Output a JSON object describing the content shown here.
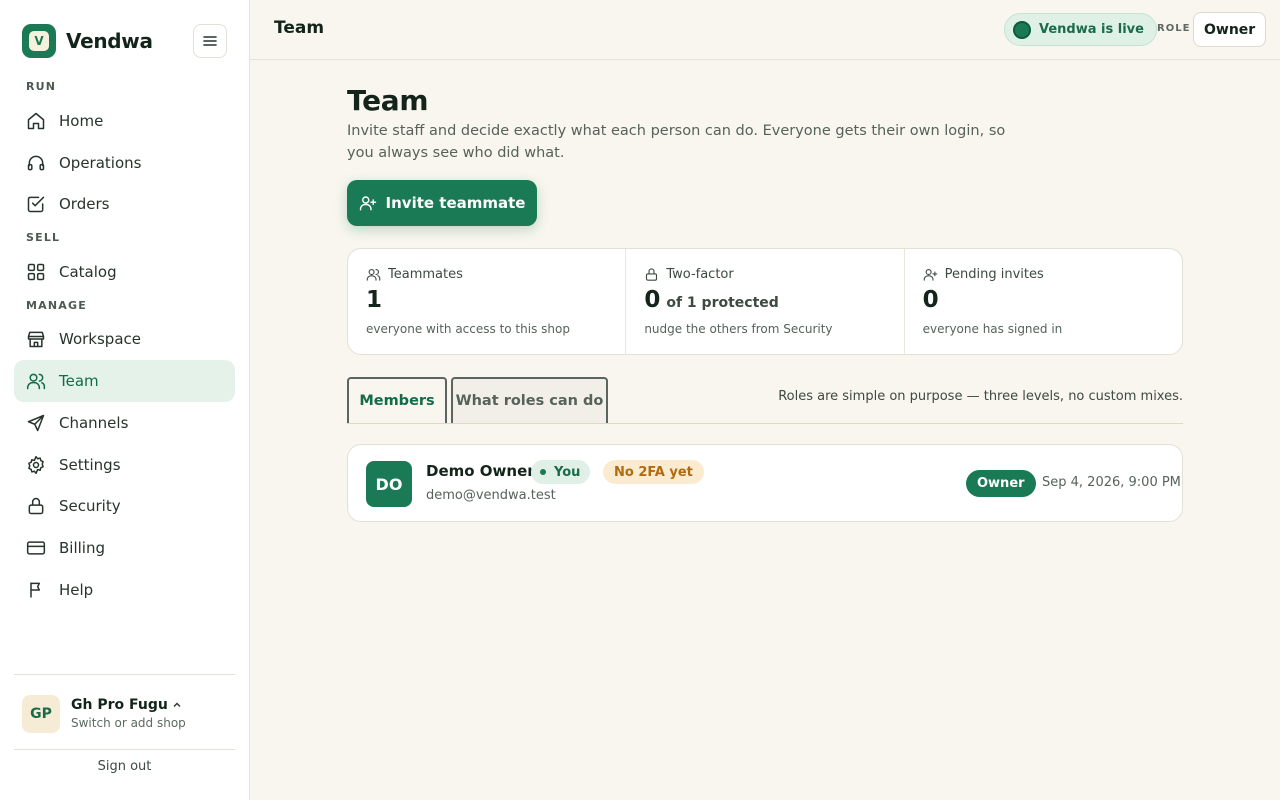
{
  "brand": {
    "name": "Vendwa",
    "logo_letter": "V"
  },
  "sidebar": {
    "sections": {
      "run": "RUN",
      "sell": "SELL",
      "manage": "MANAGE"
    },
    "items": [
      {
        "label": "Home",
        "icon": "home-icon"
      },
      {
        "label": "Operations",
        "icon": "headset-icon"
      },
      {
        "label": "Orders",
        "icon": "checkbox-icon"
      },
      {
        "label": "Catalog",
        "icon": "grid-icon"
      },
      {
        "label": "Workspace",
        "icon": "store-icon"
      },
      {
        "label": "Team",
        "icon": "users-icon",
        "active": true
      },
      {
        "label": "Channels",
        "icon": "send-icon"
      },
      {
        "label": "Settings",
        "icon": "gear-icon"
      },
      {
        "label": "Security",
        "icon": "lock-icon"
      },
      {
        "label": "Billing",
        "icon": "card-icon"
      },
      {
        "label": "Help",
        "icon": "flag-icon"
      }
    ],
    "shop": {
      "initials": "GP",
      "name": "Gh Pro Fugu",
      "subtitle": "Switch or add shop"
    },
    "sign_out": "Sign out"
  },
  "topbar": {
    "title": "Team",
    "live_status": "Vendwa is live",
    "role_label": "ROLE",
    "role_value": "Owner"
  },
  "main": {
    "title": "Team",
    "description": "Invite staff and decide exactly what each person can do. Everyone gets their own login, so you always see who did what.",
    "invite_button": "Invite teammate",
    "stats": [
      {
        "label": "Teammates",
        "value": "1",
        "sub": "",
        "note": "everyone with access to this shop",
        "icon": "users-icon"
      },
      {
        "label": "Two-factor",
        "value": "0",
        "sub": "of 1 protected",
        "note": "nudge the others from Security",
        "icon": "lock-icon"
      },
      {
        "label": "Pending invites",
        "value": "0",
        "sub": "",
        "note": "everyone has signed in",
        "icon": "user-plus-icon"
      }
    ],
    "tabs": [
      {
        "label": "Members",
        "active": true
      },
      {
        "label": "What roles can do",
        "active": false
      }
    ],
    "tabs_note": "Roles are simple on purpose — three levels, no custom mixes.",
    "members": [
      {
        "initials": "DO",
        "name": "Demo Owner",
        "you_badge": "You",
        "twofa_badge": "No 2FA yet",
        "email": "demo@vendwa.test",
        "role": "Owner",
        "date": "Sep 4, 2026, 9:00 PM"
      }
    ]
  },
  "colors": {
    "accent": "#1a7a55",
    "background": "#f8f6ef",
    "warning": "#b06a10"
  }
}
